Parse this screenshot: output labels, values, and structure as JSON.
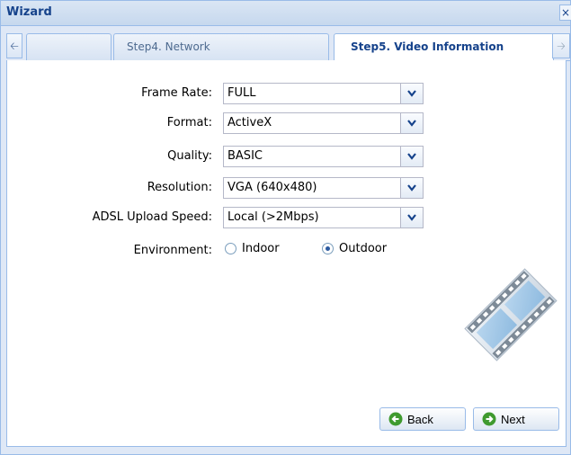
{
  "window": {
    "title": "Wizard",
    "close_glyph": "×"
  },
  "tabs": [
    {
      "label": ""
    },
    {
      "label": "Step4. Network"
    },
    {
      "label": "Step5. Video Information",
      "active": true
    }
  ],
  "form": {
    "frame_rate": {
      "label": "Frame Rate:",
      "value": "FULL"
    },
    "format": {
      "label": "Format:",
      "value": "ActiveX"
    },
    "quality": {
      "label": "Quality:",
      "value": "BASIC"
    },
    "resolution": {
      "label": "Resolution:",
      "value": "VGA (640x480)"
    },
    "adsl_upload_speed": {
      "label": "ADSL Upload Speed:",
      "value": "Local (>2Mbps)"
    },
    "environment": {
      "label": "Environment:",
      "options": [
        {
          "label": "Indoor",
          "checked": false
        },
        {
          "label": "Outdoor",
          "checked": true
        }
      ]
    }
  },
  "buttons": {
    "back_label": "Back",
    "next_label": "Next"
  },
  "icons": {
    "scroll_left": "arrow-left-icon",
    "scroll_right": "arrow-right-icon",
    "dropdown": "chevron-down-icon",
    "back": "back-arrow-icon",
    "next": "next-arrow-icon",
    "decor": "film-strip-icon"
  },
  "colors": {
    "accent": "#15428b",
    "border": "#99bbe8",
    "button_icon": "#3f9a2f"
  }
}
